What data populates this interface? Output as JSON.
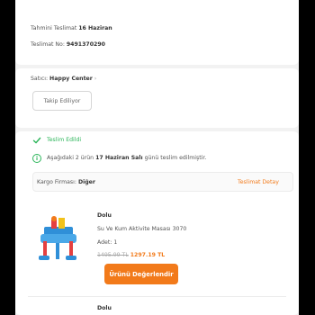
{
  "delivery": {
    "estimated_label": "Tahmini Teslimat",
    "estimated_value": "16 Haziran",
    "delivery_no_label": "Teslimat No:",
    "delivery_no_value": "9491370290"
  },
  "seller": {
    "label": "Satıcı:",
    "name": "Happy Center",
    "chevron": "›",
    "follow_button": "Takip Ediliyor"
  },
  "shipment": {
    "status": "Teslim Edildi",
    "note_prefix": "Aşağıdaki 2 ürün",
    "note_date": "17 Haziran Salı",
    "note_suffix": "günü teslim edilmiştir.",
    "cargo_label": "Kargo Firması:",
    "cargo_value": "Diğer",
    "details_link": "Teslimat Detay"
  },
  "products": [
    {
      "brand": "Dolu",
      "name": "Su Ve Kum Aktivite Masası 3070",
      "quantity": "Adet: 1",
      "old_price": "1495.99 TL",
      "price": "1297.19 TL",
      "rate_button": "Ürünü Değerlendir"
    },
    {
      "brand": "Dolu"
    }
  ],
  "colors": {
    "accent": "#f27a1a",
    "success": "#2cb55a"
  }
}
